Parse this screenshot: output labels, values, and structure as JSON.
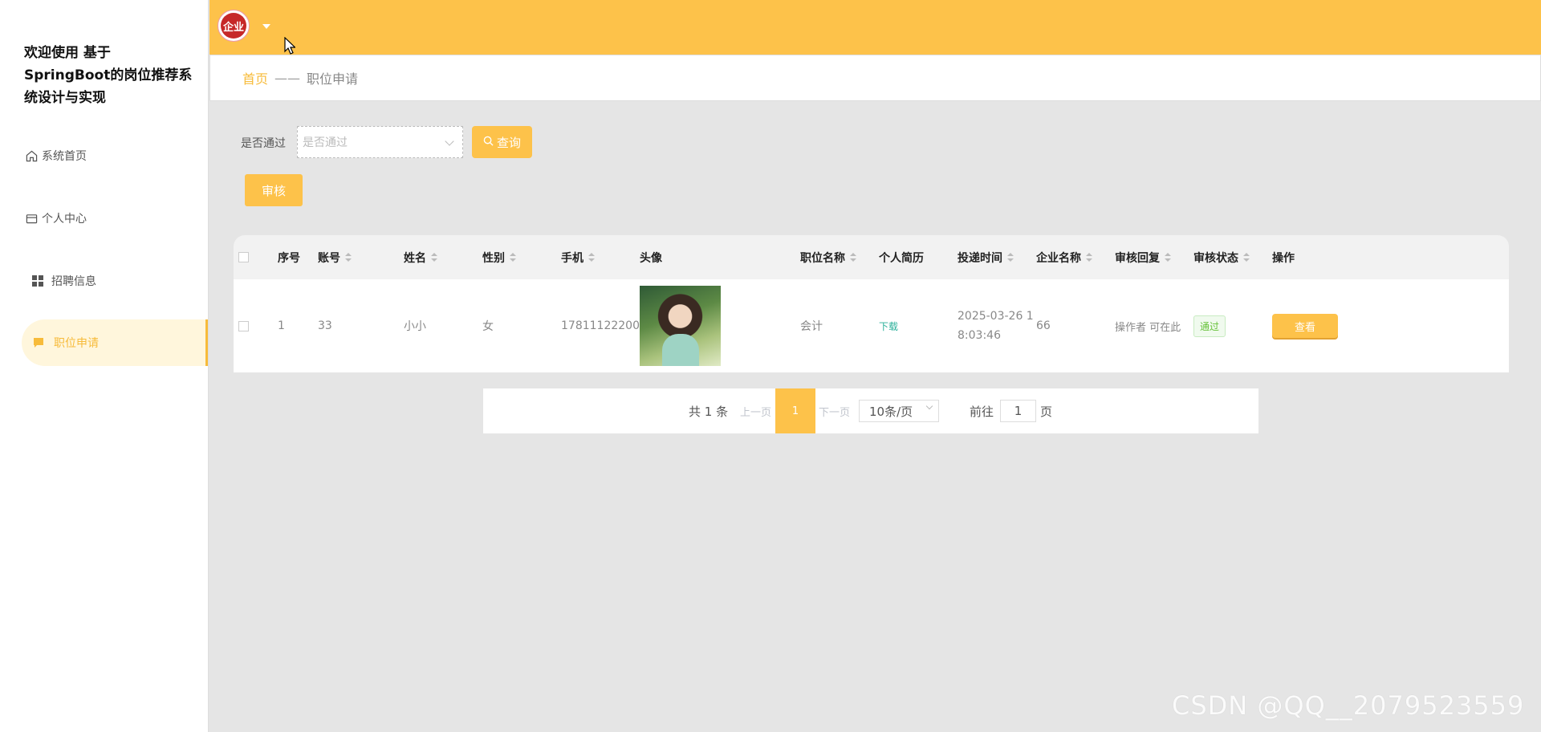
{
  "app": {
    "title": "欢迎使用 基于SpringBoot的岗位推荐系统设计与实现"
  },
  "sidebar": {
    "items": [
      {
        "label": "系统首页",
        "icon": "home-icon"
      },
      {
        "label": "个人中心",
        "icon": "user-card-icon"
      },
      {
        "label": "招聘信息",
        "icon": "grid-icon"
      },
      {
        "label": "职位申请",
        "icon": "chat-icon",
        "active": true
      }
    ]
  },
  "header": {
    "avatar_text": "企业"
  },
  "breadcrumb": {
    "home": "首页",
    "separator": "——",
    "current": "职位申请"
  },
  "filter": {
    "label": "是否通过",
    "placeholder": "是否通过",
    "query_label": "查询"
  },
  "toolbar": {
    "audit_label": "审核"
  },
  "table": {
    "headers": [
      "序号",
      "账号",
      "姓名",
      "性别",
      "手机",
      "头像",
      "职位名称",
      "个人简历",
      "投递时间",
      "企业名称",
      "审核回复",
      "审核状态",
      "操作"
    ],
    "rows": [
      {
        "index": "1",
        "account": "33",
        "name": "小小",
        "gender": "女",
        "phone": "17811122200",
        "position": "会计",
        "resume": "下载",
        "time_line1": "2025-03-26 1",
        "time_line2": "8:03:46",
        "company": "66",
        "reply": "操作者 可在此",
        "status": "通过",
        "action": "查看"
      }
    ]
  },
  "pagination": {
    "total": "共 1 条",
    "prev": "上一页",
    "current_page": "1",
    "next": "下一页",
    "page_size": "10条/页",
    "goto_label": "前往",
    "goto_value": "1",
    "page_suffix": "页"
  },
  "watermark": "CSDN @QQ__2079523559",
  "colors": {
    "accent": "#fdc24a",
    "accent_text": "#f7bb3a",
    "pass_green": "#67c23a",
    "download_teal": "#2bb09a"
  }
}
